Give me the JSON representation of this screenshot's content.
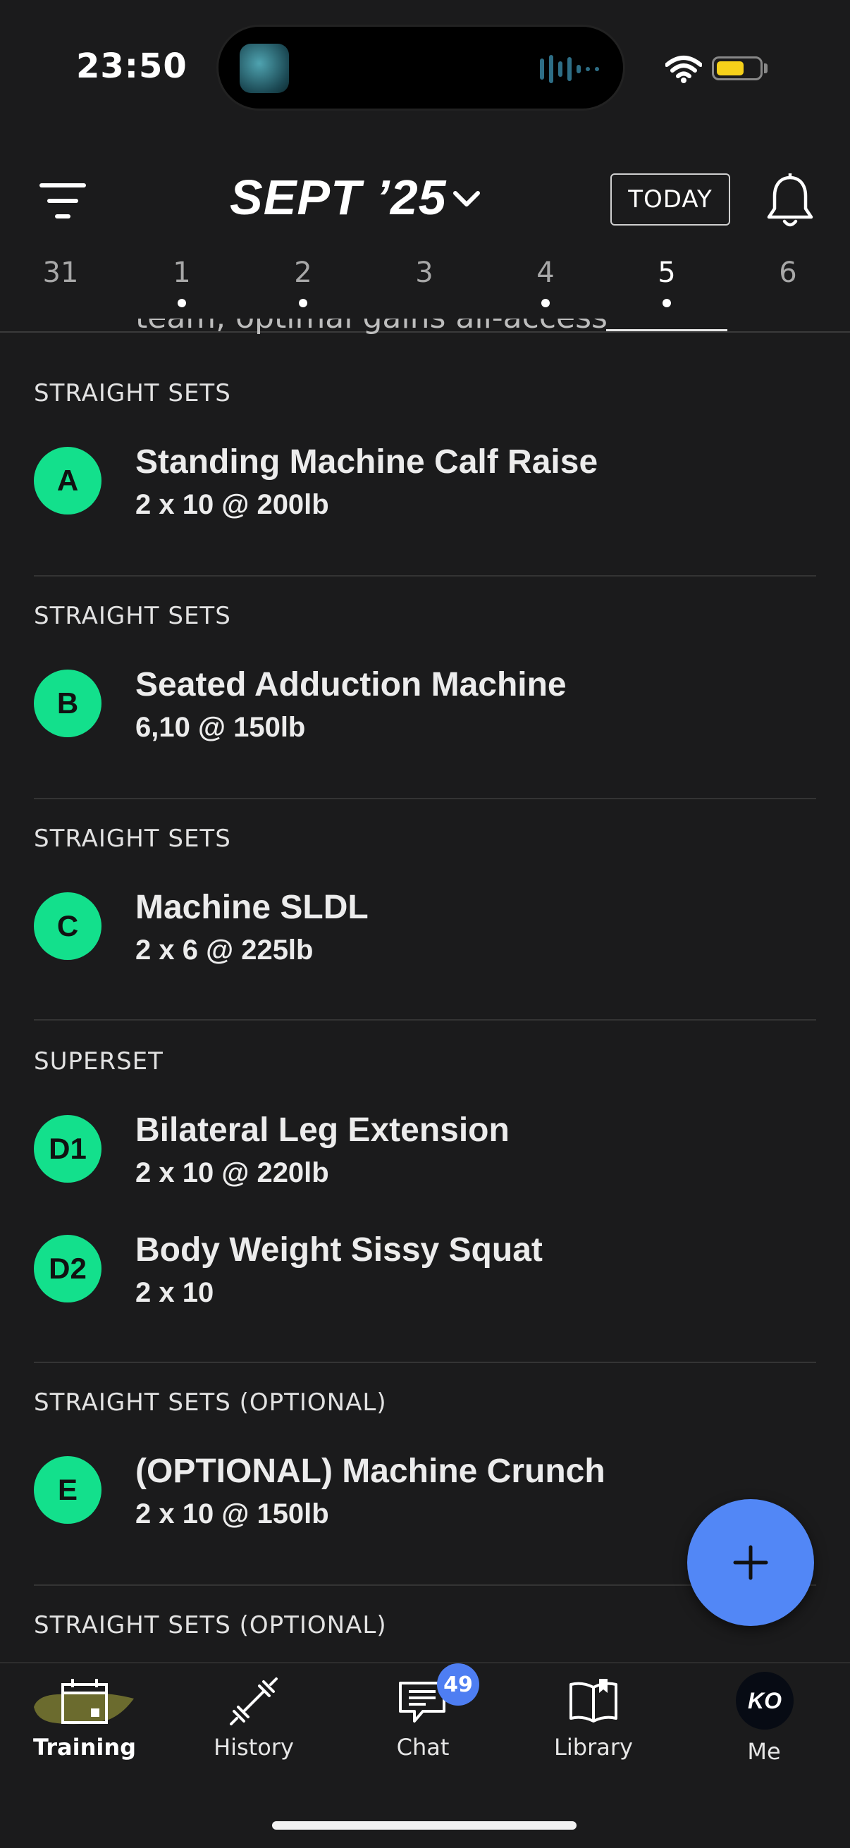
{
  "status_bar": {
    "time": "23:50"
  },
  "header": {
    "month_title": "SEPT ’25",
    "today_label": "TODAY",
    "dates": [
      {
        "label": "31",
        "has_dot": false,
        "selected": false
      },
      {
        "label": "1",
        "has_dot": true,
        "selected": false
      },
      {
        "label": "2",
        "has_dot": true,
        "selected": false
      },
      {
        "label": "3",
        "has_dot": false,
        "selected": false
      },
      {
        "label": "4",
        "has_dot": true,
        "selected": false
      },
      {
        "label": "5",
        "has_dot": true,
        "selected": true
      },
      {
        "label": "6",
        "has_dot": false,
        "selected": false
      }
    ]
  },
  "peek_text": "team, optimal gains all-access",
  "sections": [
    {
      "label": "STRAIGHT SETS",
      "exercises": [
        {
          "badge": "A",
          "name": "Standing Machine Calf Raise",
          "detail": "2 x 10 @ 200lb"
        }
      ]
    },
    {
      "label": "STRAIGHT SETS",
      "exercises": [
        {
          "badge": "B",
          "name": "Seated Adduction Machine",
          "detail": "6,10 @ 150lb"
        }
      ]
    },
    {
      "label": "STRAIGHT SETS",
      "exercises": [
        {
          "badge": "C",
          "name": "Machine SLDL",
          "detail": "2 x 6 @ 225lb"
        }
      ]
    },
    {
      "label": "SUPERSET",
      "exercises": [
        {
          "badge": "D1",
          "name": "Bilateral Leg Extension",
          "detail": "2 x 10 @ 220lb"
        },
        {
          "badge": "D2",
          "name": "Body Weight Sissy Squat",
          "detail": "2 x 10"
        }
      ]
    },
    {
      "label": "STRAIGHT SETS (OPTIONAL)",
      "exercises": [
        {
          "badge": "E",
          "name": "(OPTIONAL) Machine Crunch",
          "detail": "2 x 10 @ 150lb"
        }
      ]
    },
    {
      "label": "STRAIGHT SETS (OPTIONAL)",
      "exercises": []
    }
  ],
  "tabs": [
    {
      "label": "Training",
      "icon": "calendar-icon",
      "active": true
    },
    {
      "label": "History",
      "icon": "dumbbell-icon",
      "active": false
    },
    {
      "label": "Chat",
      "icon": "chat-icon",
      "active": false,
      "badge": "49"
    },
    {
      "label": "Library",
      "icon": "book-icon",
      "active": false
    },
    {
      "label": "Me",
      "icon": "avatar",
      "active": false,
      "avatar_initials": "KO"
    }
  ],
  "colors": {
    "accent_green": "#13e08c",
    "fab_blue": "#5287f6",
    "background": "#1b1b1c"
  }
}
